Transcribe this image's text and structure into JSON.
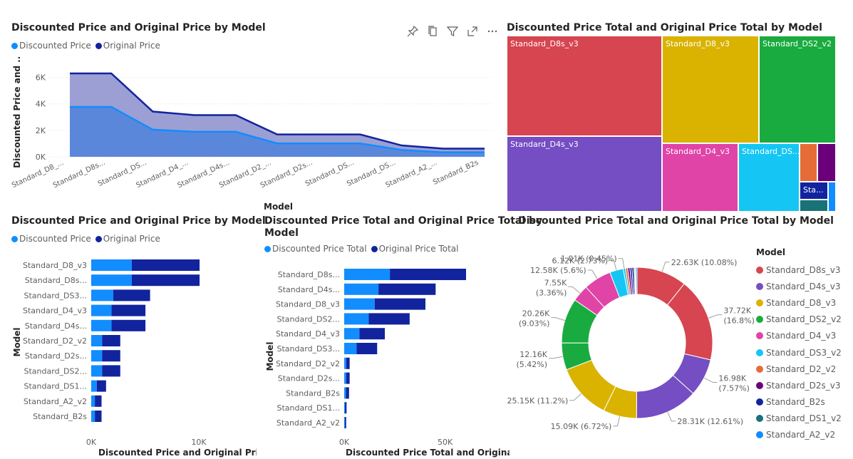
{
  "colors": {
    "discounted": "#118DFF",
    "original": "#12239E",
    "area_discounted": "#5B87DB",
    "area_original": "#9B9FD3",
    "axis_text": "#605e5c",
    "gridline": "#e6e6e6"
  },
  "toolbar": {
    "pin_icon": "pin-icon",
    "copy_icon": "copy-icon",
    "filter_icon": "filter-icon",
    "focus_icon": "focus-mode-icon",
    "more_icon": "more-options-icon"
  },
  "visual1": {
    "title": "Discounted Price and Original Price by Model",
    "legend": [
      {
        "label": "Discounted Price",
        "color": "#118DFF"
      },
      {
        "label": "Original Price",
        "color": "#12239E"
      }
    ]
  },
  "visual2": {
    "title": "Discounted Price Total and Original Price Total by Model"
  },
  "visual3": {
    "title": "Discounted Price and Original Price by Model",
    "legend": [
      {
        "label": "Discounted Price",
        "color": "#118DFF"
      },
      {
        "label": "Original Price",
        "color": "#12239E"
      }
    ]
  },
  "visual4": {
    "title_line1": "Discounted Price Total and Original Price Total by",
    "title_line2": "Model",
    "legend": [
      {
        "label": "Discounted Price Total",
        "color": "#118DFF"
      },
      {
        "label": "Original Price Total",
        "color": "#12239E"
      }
    ]
  },
  "visual5": {
    "title": "Discounted Price Total and Original Price Total by Model",
    "legend_title": "Model"
  },
  "chart_data": [
    {
      "id": "area",
      "type": "area",
      "title": "Discounted Price and Original Price by Model",
      "xlabel": "Model",
      "ylabel": "Discounted Price and ...",
      "ylim": [
        0,
        7000
      ],
      "yticks": [
        0,
        2000,
        4000,
        6000
      ],
      "ytick_labels": [
        "0K",
        "2K",
        "4K",
        "6K"
      ],
      "categories": [
        "Standard_D8_...",
        "Standard_D8s...",
        "Standard_DS...",
        "Standard_D4_...",
        "Standard_D4s...",
        "Standard_D2_...",
        "Standard_D2s...",
        "Standard_DS...",
        "Standard_DS...",
        "Standard_A2_...",
        "Standard_B2s"
      ],
      "series": [
        {
          "name": "Discounted Price",
          "values": [
            3770,
            3770,
            2050,
            1890,
            1890,
            1010,
            1010,
            1010,
            520,
            340,
            340
          ]
        },
        {
          "name": "Original Price",
          "values": [
            6300,
            6300,
            3420,
            3150,
            3150,
            1690,
            1690,
            1690,
            860,
            620,
            620
          ]
        }
      ],
      "grid": true,
      "legend_position": "top-left"
    },
    {
      "id": "treemap",
      "type": "treemap",
      "title": "Discounted Price Total and Original Price Total by Model",
      "items": [
        {
          "label": "Standard_D8s_v3",
          "value": 60350,
          "color": "#D64550"
        },
        {
          "label": "Standard_D8_v3",
          "value": 37720,
          "color": "#D9B300"
        },
        {
          "label": "Standard_DS2_v2",
          "value": 32440,
          "color": "#1AAB40"
        },
        {
          "label": "Standard_D4s_v3",
          "value": 45290,
          "color": "#744EC2"
        },
        {
          "label": "Standard_D4_v3",
          "value": 20120,
          "color": "#E044A7"
        },
        {
          "label": "Standard_DS...",
          "value": 16290,
          "color": "#15C6F4"
        },
        {
          "label": "",
          "value": 2600,
          "color": "#E66C37"
        },
        {
          "label": "",
          "value": 2600,
          "color": "#6B007B"
        },
        {
          "label": "Sta...",
          "value": 2300,
          "color": "#12239E"
        },
        {
          "label": "",
          "value": 1000,
          "color": "#197278"
        },
        {
          "label": "",
          "value": 900,
          "color": "#118DFF"
        }
      ]
    },
    {
      "id": "bar1",
      "type": "bar",
      "orientation": "horizontal",
      "stacked": true,
      "title": "Discounted Price and Original Price by Model",
      "xlabel": "Discounted Price and Original Price",
      "ylabel": "Model",
      "xlim": [
        0,
        10000
      ],
      "xticks": [
        0,
        10000
      ],
      "xtick_labels": [
        "0K",
        "10K"
      ],
      "categories": [
        "Standard_D8_v3",
        "Standard_D8s...",
        "Standard_DS3...",
        "Standard_D4_v3",
        "Standard_D4s...",
        "Standard_D2_v2",
        "Standard_D2s...",
        "Standard_DS2...",
        "Standard_DS1...",
        "Standard_A2_v2",
        "Standard_B2s"
      ],
      "series": [
        {
          "name": "Discounted Price",
          "values": [
            3770,
            3770,
            2050,
            1890,
            1890,
            1010,
            1010,
            1010,
            520,
            340,
            340
          ]
        },
        {
          "name": "Original Price",
          "values": [
            6300,
            6300,
            3420,
            3150,
            3150,
            1690,
            1690,
            1690,
            860,
            620,
            620
          ]
        }
      ]
    },
    {
      "id": "bar2",
      "type": "bar",
      "orientation": "horizontal",
      "stacked": true,
      "title": "Discounted Price Total and Original Price Total by Model",
      "xlabel": "Discounted Price Total and Original P...",
      "ylabel": "Model",
      "xlim": [
        0,
        60000
      ],
      "xticks": [
        0,
        50000
      ],
      "xtick_labels": [
        "0K",
        "50K"
      ],
      "categories": [
        "Standard_D8s...",
        "Standard_D4s...",
        "Standard_D8_v3",
        "Standard_DS2...",
        "Standard_D4_v3",
        "Standard_DS3...",
        "Standard_D2_v2",
        "Standard_D2s...",
        "Standard_B2s",
        "Standard_DS1...",
        "Standard_A2_v2"
      ],
      "series": [
        {
          "name": "Discounted Price Total",
          "values": [
            22630,
            16980,
            15090,
            12160,
            7550,
            6120,
            1010,
            1010,
            900,
            440,
            340
          ]
        },
        {
          "name": "Original Price Total",
          "values": [
            37720,
            28310,
            25150,
            20260,
            12580,
            10200,
            1690,
            1690,
            1500,
            730,
            620
          ]
        }
      ]
    },
    {
      "id": "donut",
      "type": "pie",
      "donut": true,
      "title": "Discounted Price Total and Original Price Total by Model",
      "slices": [
        {
          "label": "22.63K (10.08%)",
          "value": 22630,
          "color": "#D64550"
        },
        {
          "label": "37.72K (16.8%)",
          "value": 37720,
          "color": "#D64550"
        },
        {
          "label": "16.98K (7.57%)",
          "value": 16980,
          "color": "#744EC2"
        },
        {
          "label": "28.31K (12.61%)",
          "value": 28310,
          "color": "#744EC2"
        },
        {
          "label": "15.09K (6.72%)",
          "value": 15090,
          "color": "#D9B300"
        },
        {
          "label": "25.15K (11.2%)",
          "value": 25150,
          "color": "#D9B300"
        },
        {
          "label": "12.16K (5.42%)",
          "value": 12160,
          "color": "#1AAB40"
        },
        {
          "label": "20.26K (9.03%)",
          "value": 20260,
          "color": "#1AAB40"
        },
        {
          "label": "7.55K (3.36%)",
          "value": 7550,
          "color": "#E044A7"
        },
        {
          "label": "12.58K (5.6%)",
          "value": 12580,
          "color": "#E044A7"
        },
        {
          "label": "6.12K (2.73%)",
          "value": 6120,
          "color": "#15C6F4"
        },
        {
          "label": "1.01K (0.45%)",
          "value": 1010,
          "color": "#15C6F4"
        },
        {
          "label": "",
          "value": 1010,
          "color": "#E66C37"
        },
        {
          "label": "",
          "value": 1010,
          "color": "#6B007B"
        },
        {
          "label": "",
          "value": 900,
          "color": "#12239E"
        },
        {
          "label": "",
          "value": 900,
          "color": "#12239E"
        },
        {
          "label": "",
          "value": 440,
          "color": "#197278"
        },
        {
          "label": "",
          "value": 340,
          "color": "#118DFF"
        },
        {
          "label": "",
          "value": 620,
          "color": "#118DFF"
        }
      ],
      "legend": [
        {
          "label": "Standard_D8s_v3",
          "color": "#D64550"
        },
        {
          "label": "Standard_D4s_v3",
          "color": "#744EC2"
        },
        {
          "label": "Standard_D8_v3",
          "color": "#D9B300"
        },
        {
          "label": "Standard_DS2_v2",
          "color": "#1AAB40"
        },
        {
          "label": "Standard_D4_v3",
          "color": "#E044A7"
        },
        {
          "label": "Standard_DS3_v2",
          "color": "#15C6F4"
        },
        {
          "label": "Standard_D2_v2",
          "color": "#E66C37"
        },
        {
          "label": "Standard_D2s_v3",
          "color": "#6B007B"
        },
        {
          "label": "Standard_B2s",
          "color": "#12239E"
        },
        {
          "label": "Standard_DS1_v2",
          "color": "#197278"
        },
        {
          "label": "Standard_A2_v2",
          "color": "#118DFF"
        }
      ]
    }
  ]
}
